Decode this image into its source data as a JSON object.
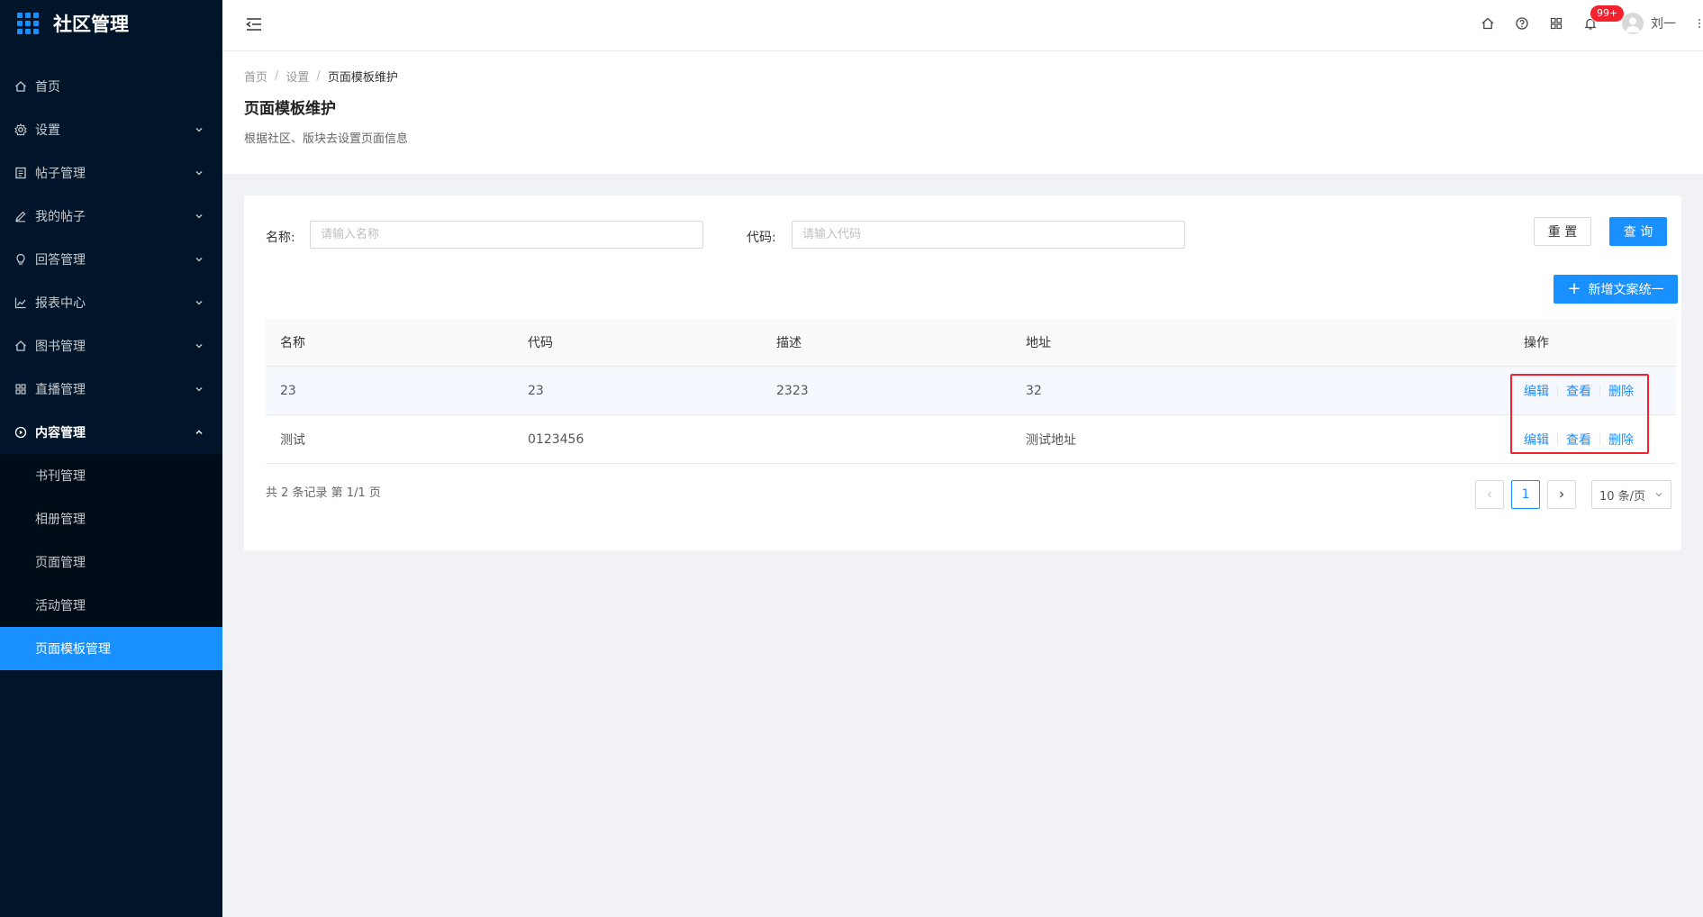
{
  "app": {
    "title": "社区管理"
  },
  "sidebar": {
    "items": [
      {
        "label": "首页",
        "icon": "home-icon",
        "has_arrow": false
      },
      {
        "label": "设置",
        "icon": "gear-icon",
        "has_arrow": true
      },
      {
        "label": "帖子管理",
        "icon": "document-icon",
        "has_arrow": true
      },
      {
        "label": "我的帖子",
        "icon": "edit-icon",
        "has_arrow": true
      },
      {
        "label": "回答管理",
        "icon": "bulb-icon",
        "has_arrow": true
      },
      {
        "label": "报表中心",
        "icon": "line-chart-icon",
        "has_arrow": true
      },
      {
        "label": "图书管理",
        "icon": "home-icon",
        "has_arrow": true
      },
      {
        "label": "直播管理",
        "icon": "grid-icon",
        "has_arrow": true
      }
    ],
    "open_group": {
      "label": "内容管理",
      "icon": "play-circle-icon",
      "children": [
        {
          "label": "书刊管理",
          "active": false
        },
        {
          "label": "相册管理",
          "active": false
        },
        {
          "label": "页面管理",
          "active": false
        },
        {
          "label": "活动管理",
          "active": false
        },
        {
          "label": "页面模板管理",
          "active": true
        }
      ]
    }
  },
  "header": {
    "notification_badge": "99+",
    "username": "刘一"
  },
  "page": {
    "breadcrumb": [
      "首页",
      "设置",
      "页面模板维护"
    ],
    "title": "页面模板维护",
    "description": "根据社区、版块去设置页面信息"
  },
  "search": {
    "name_label": "名称:",
    "name_placeholder": "请输入名称",
    "code_label": "代码:",
    "code_placeholder": "请输入代码",
    "reset_label": "重 置",
    "query_label": "查 询",
    "add_label": "新增文案统一"
  },
  "table": {
    "columns": [
      "名称",
      "代码",
      "描述",
      "地址",
      "操作"
    ],
    "rows": [
      {
        "name": "23",
        "code": "23",
        "desc": "2323",
        "address": "32"
      },
      {
        "name": "测试",
        "code": "0123456",
        "desc": "",
        "address": "测试地址"
      }
    ],
    "actions": [
      "编辑",
      "查看",
      "删除"
    ]
  },
  "pagination": {
    "summary": "共 2 条记录 第 1/1 页",
    "current_page": "1",
    "page_size": "10 条/页"
  },
  "colors": {
    "sidebar_bg": "#001529",
    "submenu_bg": "#000c17",
    "primary": "#1890ff",
    "highlight_frame": "#f5222d"
  }
}
